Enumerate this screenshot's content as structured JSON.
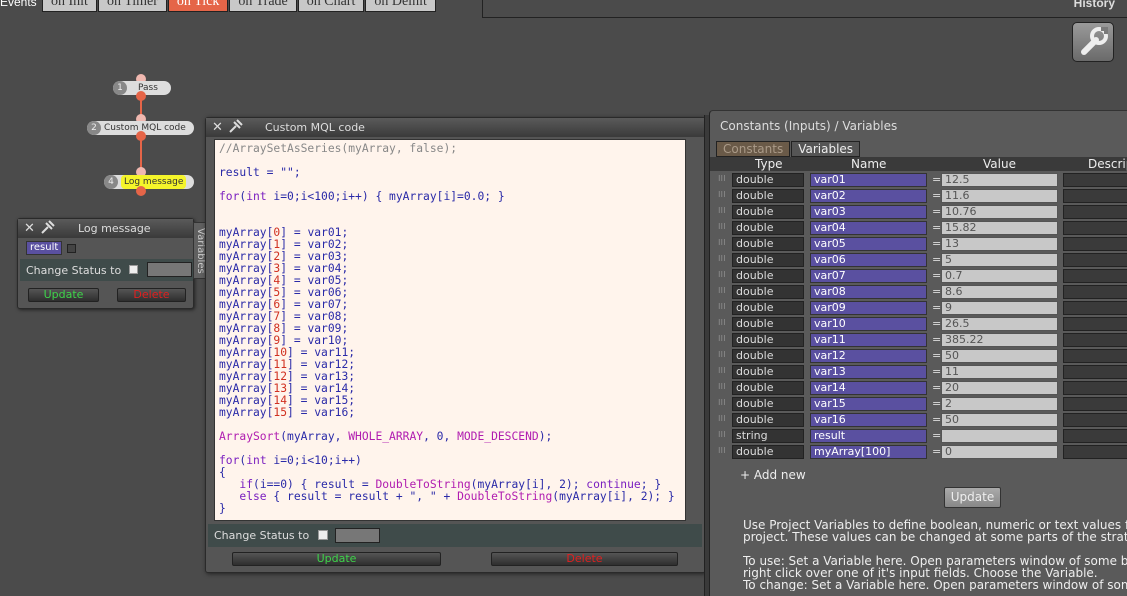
{
  "topbar": {
    "events_label": "Events",
    "tabs": [
      "on Init",
      "on Timer",
      "on Tick",
      "on Trade",
      "on Chart",
      "on Deinit"
    ],
    "active_tab": "on Tick",
    "history_label": "History"
  },
  "nodes": [
    {
      "num": "1",
      "label": "Pass"
    },
    {
      "num": "2",
      "label": "Custom MQL code"
    },
    {
      "num": "4",
      "label": "Log message"
    }
  ],
  "log_window": {
    "title": "Log message",
    "result_tag": "result",
    "change_status_label": "Change Status to",
    "update_label": "Update",
    "delete_label": "Delete"
  },
  "variables_side_tab": "Variables",
  "code_window": {
    "title": "Custom MQL code",
    "lines": [
      "//ArraySetAsSeries(myArray, false);",
      "",
      "result = \"\";",
      "",
      "for(int i=0;i<100;i++) { myArray[i]=0.0; }",
      "",
      "",
      "myArray[0] = var01;",
      "myArray[1] = var02;",
      "myArray[2] = var03;",
      "myArray[3] = var04;",
      "myArray[4] = var05;",
      "myArray[5] = var06;",
      "myArray[6] = var07;",
      "myArray[7] = var08;",
      "myArray[8] = var09;",
      "myArray[9] = var10;",
      "myArray[10] = var11;",
      "myArray[11] = var12;",
      "myArray[12] = var13;",
      "myArray[13] = var14;",
      "myArray[14] = var15;",
      "myArray[15] = var16;",
      "",
      "ArraySort(myArray, WHOLE_ARRAY, 0, MODE_DESCEND);",
      "",
      "for(int i=0;i<10;i++)",
      "{",
      "   if(i==0) { result = DoubleToString(myArray[i], 2); continue; }",
      "   else { result = result + \", \" + DoubleToString(myArray[i], 2); }",
      "}"
    ],
    "change_status_label": "Change Status to",
    "update_label": "Update",
    "delete_label": "Delete"
  },
  "vars_panel": {
    "title": "Constants (Inputs) / Variables",
    "tabs": [
      "Constants",
      "Variables"
    ],
    "active_tab": "Variables",
    "headers": {
      "type": "Type",
      "name": "Name",
      "value": "Value",
      "desc": "Descrip"
    },
    "rows": [
      {
        "type": "double",
        "name": "var01",
        "value": "12.5"
      },
      {
        "type": "double",
        "name": "var02",
        "value": "11.6"
      },
      {
        "type": "double",
        "name": "var03",
        "value": "10.76"
      },
      {
        "type": "double",
        "name": "var04",
        "value": "15.82"
      },
      {
        "type": "double",
        "name": "var05",
        "value": "13"
      },
      {
        "type": "double",
        "name": "var06",
        "value": "5"
      },
      {
        "type": "double",
        "name": "var07",
        "value": "0.7"
      },
      {
        "type": "double",
        "name": "var08",
        "value": "8.6"
      },
      {
        "type": "double",
        "name": "var09",
        "value": "9"
      },
      {
        "type": "double",
        "name": "var10",
        "value": "26.5"
      },
      {
        "type": "double",
        "name": "var11",
        "value": "385.22"
      },
      {
        "type": "double",
        "name": "var12",
        "value": "50"
      },
      {
        "type": "double",
        "name": "var13",
        "value": "11"
      },
      {
        "type": "double",
        "name": "var14",
        "value": "20"
      },
      {
        "type": "double",
        "name": "var15",
        "value": "2"
      },
      {
        "type": "double",
        "name": "var16",
        "value": "50"
      },
      {
        "type": "string",
        "name": "result",
        "value": ""
      },
      {
        "type": "double",
        "name": "myArray[100]",
        "value": "0"
      }
    ],
    "add_new_label": "+ Add new",
    "update_label": "Update",
    "help": [
      "Use Project Variables to define boolean, numeric or text values fo",
      "project. These values can be changed at some parts of the strateg",
      "To use: Set a Variable here. Open parameters window of some blo",
      "right click over one of it's input fields. Choose the Variable.",
      "To change: Set a Variable here. Open parameters window of some"
    ]
  },
  "colors": {
    "background": "#4b4b4b",
    "accent_tab": "#e56548",
    "variable_tag": "#5a50a0",
    "update_text": "#3ed44a",
    "delete_text": "#e02020"
  }
}
